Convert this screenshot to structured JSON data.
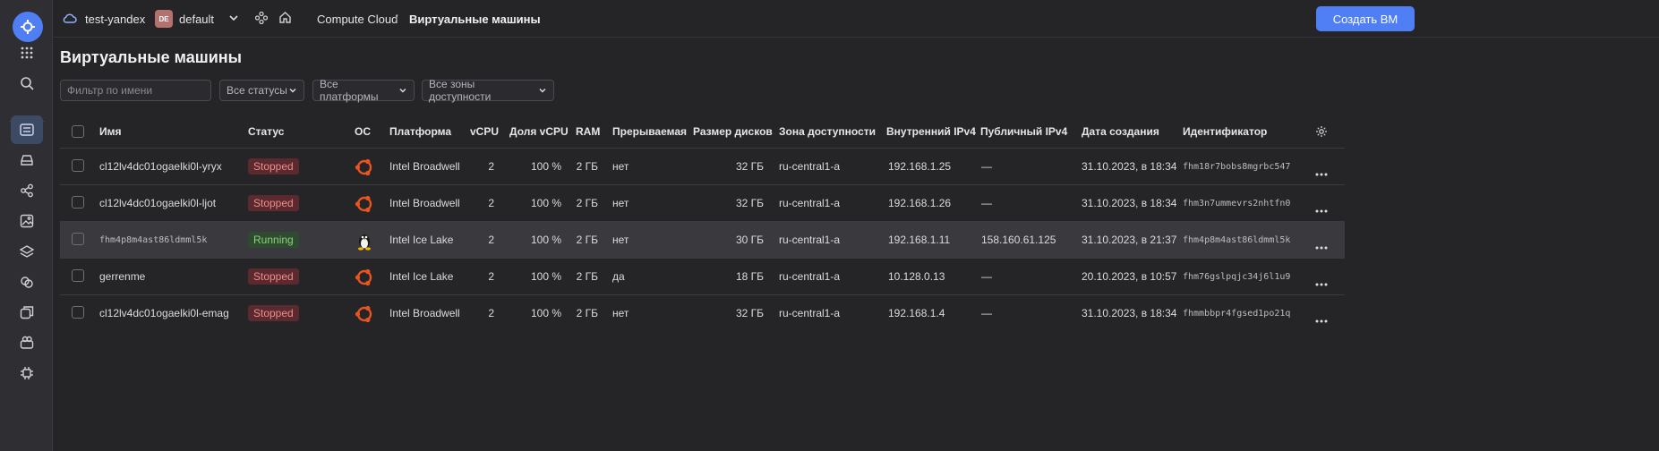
{
  "topbar": {
    "cloud": "test-yandex",
    "folder_badge": "DE",
    "folder": "default",
    "crumb_service": "Compute Cloud",
    "crumb_sep": "/",
    "crumb_current": "Виртуальные машины",
    "create_button": "Создать ВМ"
  },
  "page": {
    "title": "Виртуальные машины"
  },
  "filters": {
    "name_placeholder": "Фильтр по имени",
    "status": "Все статусы",
    "platform": "Все платформы",
    "zone": "Все зоны доступности"
  },
  "table": {
    "headers": {
      "name": "Имя",
      "status": "Статус",
      "os": "ОС",
      "platform": "Платформа",
      "vcpu": "vCPU",
      "vcpu_share": "Доля vCPU",
      "ram": "RAM",
      "preemptible": "Прерываемая",
      "disk": "Размер дисков",
      "zone": "Зона доступности",
      "ipv4_int": "Внутренний IPv4",
      "ipv4_pub": "Публичный IPv4",
      "created": "Дата создания",
      "id": "Идентификатор"
    },
    "rows": [
      {
        "name": "cl12lv4dc01ogaelki0l-yryx",
        "status": "Stopped",
        "os": "ubuntu",
        "platform": "Intel Broadwell",
        "vcpu": "2",
        "vcpu_share": "100 %",
        "ram": "2 ГБ",
        "preemptible": "нет",
        "disk": "32 ГБ",
        "zone": "ru-central1-a",
        "ipv4_int": "192.168.1.25",
        "ipv4_pub": "—",
        "created": "31.10.2023, в 18:34",
        "id": "fhm18r7bobs8mgrbc547"
      },
      {
        "name": "cl12lv4dc01ogaelki0l-ljot",
        "status": "Stopped",
        "os": "ubuntu",
        "platform": "Intel Broadwell",
        "vcpu": "2",
        "vcpu_share": "100 %",
        "ram": "2 ГБ",
        "preemptible": "нет",
        "disk": "32 ГБ",
        "zone": "ru-central1-a",
        "ipv4_int": "192.168.1.26",
        "ipv4_pub": "—",
        "created": "31.10.2023, в 18:34",
        "id": "fhm3n7ummevrs2nhtfn0"
      },
      {
        "name": "fhm4p8m4ast86ldmml5k",
        "status": "Running",
        "os": "linux",
        "platform": "Intel Ice Lake",
        "vcpu": "2",
        "vcpu_share": "100 %",
        "ram": "2 ГБ",
        "preemptible": "нет",
        "disk": "30 ГБ",
        "zone": "ru-central1-a",
        "ipv4_int": "192.168.1.11",
        "ipv4_pub": "158.160.61.125",
        "created": "31.10.2023, в 21:37",
        "id": "fhm4p8m4ast86ldmml5k"
      },
      {
        "name": "gerrenme",
        "status": "Stopped",
        "os": "ubuntu",
        "platform": "Intel Ice Lake",
        "vcpu": "2",
        "vcpu_share": "100 %",
        "ram": "2 ГБ",
        "preemptible": "да",
        "disk": "18 ГБ",
        "zone": "ru-central1-a",
        "ipv4_int": "10.128.0.13",
        "ipv4_pub": "—",
        "created": "20.10.2023, в 10:57",
        "id": "fhm76gslpqjc34j6l1u9"
      },
      {
        "name": "cl12lv4dc01ogaelki0l-emag",
        "status": "Stopped",
        "os": "ubuntu",
        "platform": "Intel Broadwell",
        "vcpu": "2",
        "vcpu_share": "100 %",
        "ram": "2 ГБ",
        "preemptible": "нет",
        "disk": "32 ГБ",
        "zone": "ru-central1-a",
        "ipv4_int": "192.168.1.4",
        "ipv4_pub": "—",
        "created": "31.10.2023, в 18:34",
        "id": "fhmmbbpr4fgsed1po21q"
      }
    ]
  },
  "colors": {
    "accent": "#4f7ef5",
    "stopped": "#f08c8c",
    "running": "#8bd17c",
    "ubuntu": "#e95420"
  }
}
